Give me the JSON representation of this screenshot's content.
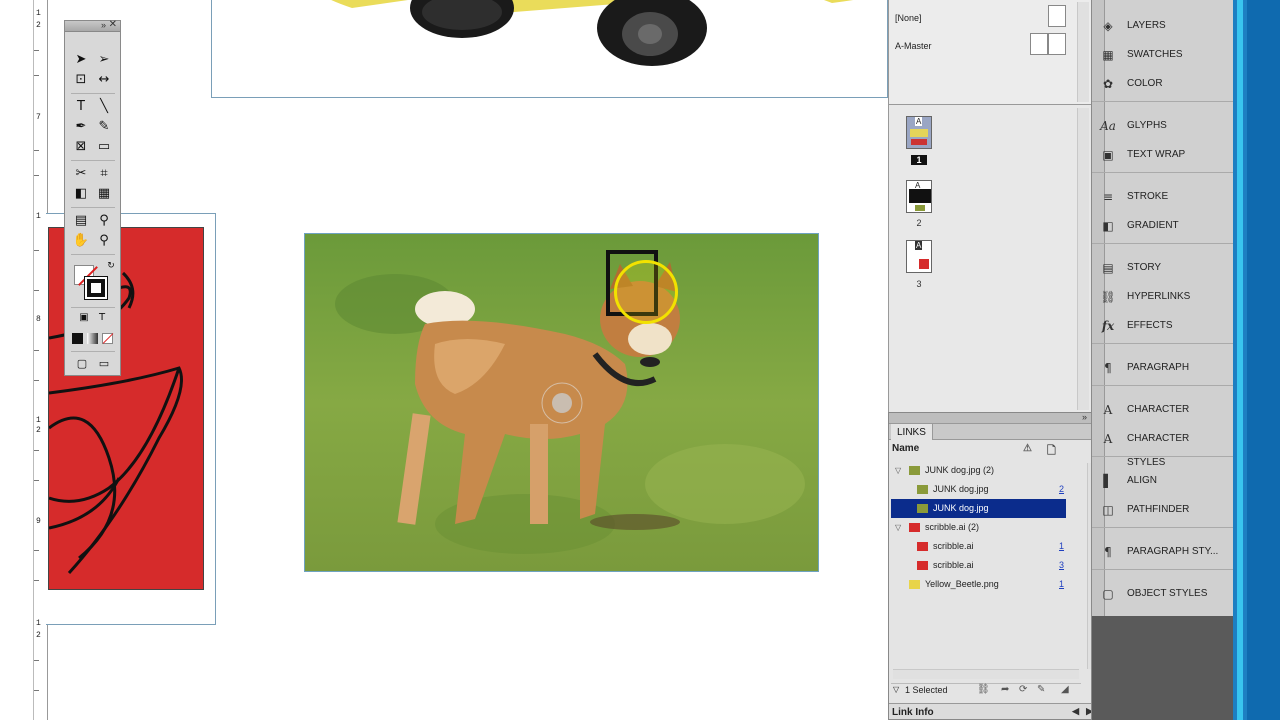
{
  "vertical_ruler": {
    "labels": [
      "1",
      "2",
      "7",
      "1",
      "8",
      "1",
      "2",
      "9",
      "1",
      "2"
    ]
  },
  "pages_panel": {
    "masters": [
      {
        "label": "[None]"
      },
      {
        "label": "A-Master"
      }
    ],
    "pages": [
      {
        "number": "1",
        "master_prefix": "A",
        "active": true
      },
      {
        "number": "2",
        "master_prefix": "A",
        "active": false
      },
      {
        "number": "3",
        "master_prefix": "A",
        "active": false
      }
    ]
  },
  "links_panel": {
    "tab_label": "LINKS",
    "column_name": "Name",
    "rows": [
      {
        "name": "JUNK dog.jpg (2)",
        "page": "",
        "group": true,
        "selected": false,
        "swatch": "#8a9a3a"
      },
      {
        "name": "JUNK dog.jpg",
        "page": "2",
        "group": false,
        "selected": false,
        "swatch": "#8a9a3a"
      },
      {
        "name": "JUNK dog.jpg",
        "page": "",
        "group": false,
        "selected": true,
        "swatch": "#8a9a3a"
      },
      {
        "name": "scribble.ai (2)",
        "page": "",
        "group": true,
        "selected": false,
        "swatch": "#d62b2b"
      },
      {
        "name": "scribble.ai",
        "page": "1",
        "group": false,
        "selected": false,
        "swatch": "#d62b2b"
      },
      {
        "name": "scribble.ai",
        "page": "3",
        "group": false,
        "selected": false,
        "swatch": "#d62b2b"
      },
      {
        "name": "Yellow_Beetle.png",
        "page": "1",
        "group": false,
        "selected": false,
        "swatch": "#e8d44a"
      }
    ],
    "status": "1 Selected",
    "link_info": "Link Info"
  },
  "dock": {
    "items": [
      {
        "label": "LAYERS",
        "icon": "layers-icon"
      },
      {
        "label": "SWATCHES",
        "icon": "swatches-icon"
      },
      {
        "label": "COLOR",
        "icon": "color-icon"
      },
      {
        "label": "GLYPHS",
        "icon": "glyphs-icon"
      },
      {
        "label": "TEXT WRAP",
        "icon": "text-wrap-icon"
      },
      {
        "label": "STROKE",
        "icon": "stroke-icon"
      },
      {
        "label": "GRADIENT",
        "icon": "gradient-icon"
      },
      {
        "label": "STORY",
        "icon": "story-icon"
      },
      {
        "label": "HYPERLINKS",
        "icon": "hyperlinks-icon"
      },
      {
        "label": "EFFECTS",
        "icon": "effects-icon"
      },
      {
        "label": "PARAGRAPH",
        "icon": "paragraph-icon"
      },
      {
        "label": "CHARACTER",
        "icon": "character-icon"
      },
      {
        "label": "CHARACTER STYLES",
        "icon": "character-styles-icon"
      },
      {
        "label": "ALIGN",
        "icon": "align-icon"
      },
      {
        "label": "PATHFINDER",
        "icon": "pathfinder-icon"
      },
      {
        "label": "PARAGRAPH STY...",
        "icon": "paragraph-styles-icon"
      },
      {
        "label": "OBJECT STYLES",
        "icon": "object-styles-icon"
      }
    ]
  },
  "colors": {
    "selection_blue": "#0b2c8c",
    "frame_border": "#6fa3c0",
    "cursor_highlight": "#f2e200",
    "desktop_blue": "#1d7fc2"
  }
}
